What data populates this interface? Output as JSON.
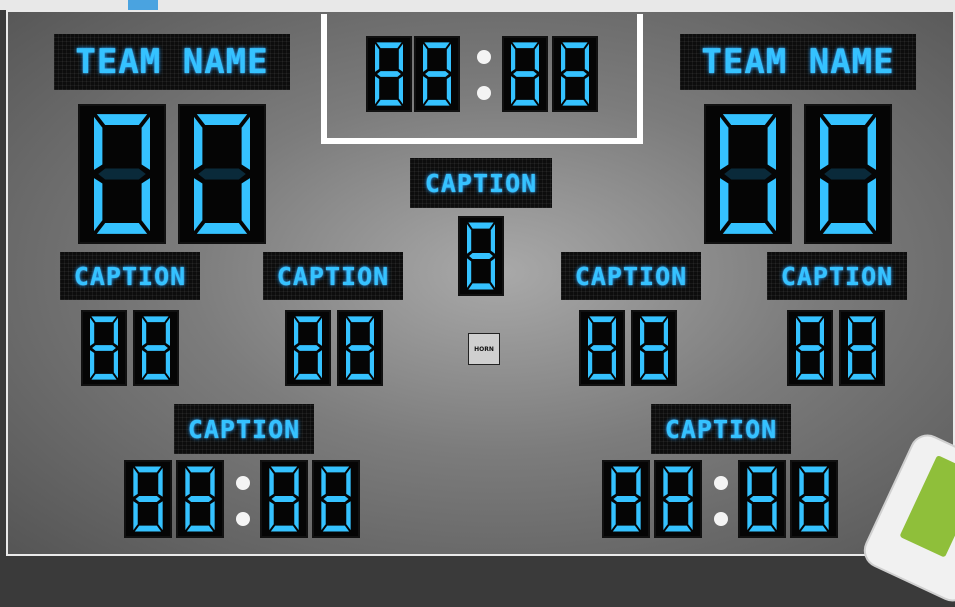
{
  "colors": {
    "led": "#35c2ff",
    "board": "#8a8a8a",
    "frame": "#ffffff"
  },
  "clock": {
    "digits": [
      "8",
      "8",
      "8",
      "8"
    ]
  },
  "home": {
    "team_name": "TEAM NAME",
    "score_digits": [
      "0",
      "0"
    ],
    "stat1": {
      "caption": "CAPTION",
      "digits": [
        "8",
        "8"
      ]
    },
    "stat2": {
      "caption": "CAPTION",
      "digits": [
        "8",
        "8"
      ]
    },
    "penalty": {
      "caption": "CAPTION",
      "digits": [
        "8",
        "8",
        "8",
        "8"
      ]
    }
  },
  "guest": {
    "team_name": "TEAM NAME",
    "score_digits": [
      "0",
      "0"
    ],
    "stat1": {
      "caption": "CAPTION",
      "digits": [
        "8",
        "8"
      ]
    },
    "stat2": {
      "caption": "CAPTION",
      "digits": [
        "8",
        "8"
      ]
    },
    "penalty": {
      "caption": "CAPTION",
      "digits": [
        "8",
        "8",
        "8",
        "8"
      ]
    }
  },
  "center": {
    "caption": "CAPTION",
    "digits": [
      "8"
    ]
  },
  "horn": {
    "label": "HORN"
  }
}
